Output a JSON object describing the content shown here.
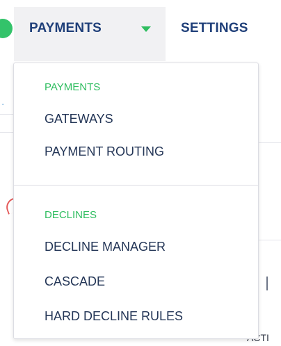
{
  "nav": {
    "payments_label": "PAYMENTS",
    "settings_label": "SETTINGS",
    "caret_icon": "caret-down-icon",
    "accent_color": "#2ebd5f",
    "text_color": "#1f3f79"
  },
  "dropdown": {
    "sections": [
      {
        "heading": "PAYMENTS",
        "items": [
          "GATEWAYS",
          "PAYMENT ROUTING"
        ]
      },
      {
        "heading": "DECLINES",
        "items": [
          "DECLINE MANAGER",
          "CASCADE",
          "HARD DECLINE RULES"
        ]
      }
    ]
  },
  "background": {
    "partial_label": "ACTI"
  }
}
